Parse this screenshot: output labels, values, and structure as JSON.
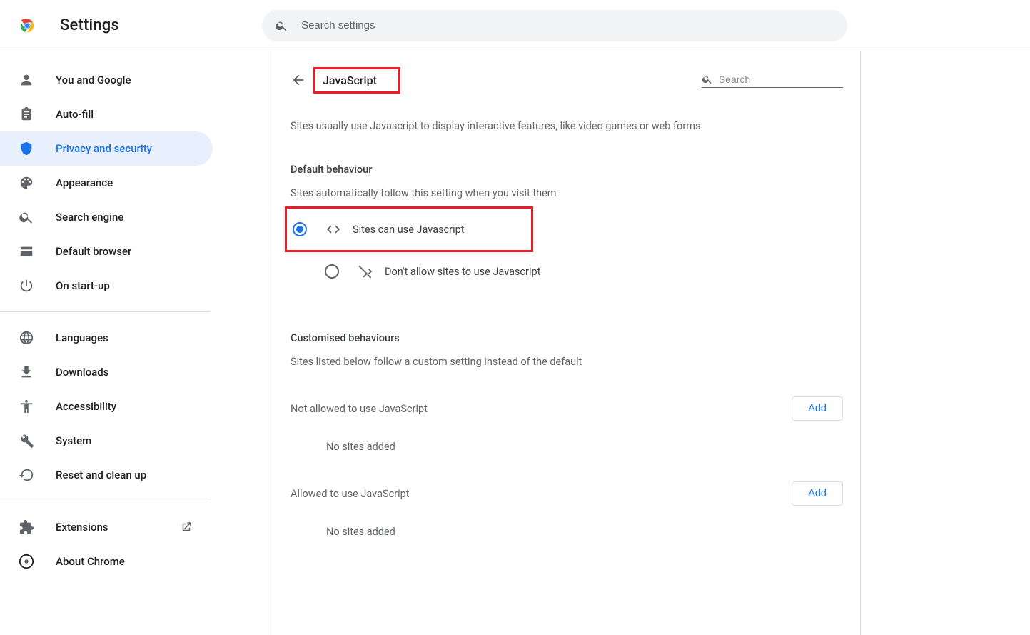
{
  "header": {
    "title": "Settings",
    "search_placeholder": "Search settings"
  },
  "sidebar": {
    "items": [
      {
        "id": "you-and-google",
        "label": "You and Google",
        "icon": "user"
      },
      {
        "id": "autofill",
        "label": "Auto-fill",
        "icon": "clipboard"
      },
      {
        "id": "privacy-security",
        "label": "Privacy and security",
        "icon": "shield",
        "active": true
      },
      {
        "id": "appearance",
        "label": "Appearance",
        "icon": "palette"
      },
      {
        "id": "search-engine",
        "label": "Search engine",
        "icon": "search"
      },
      {
        "id": "default-browser",
        "label": "Default browser",
        "icon": "window"
      },
      {
        "id": "on-startup",
        "label": "On start-up",
        "icon": "power"
      }
    ],
    "items2": [
      {
        "id": "languages",
        "label": "Languages",
        "icon": "globe"
      },
      {
        "id": "downloads",
        "label": "Downloads",
        "icon": "download"
      },
      {
        "id": "accessibility",
        "label": "Accessibility",
        "icon": "accessibility"
      },
      {
        "id": "system",
        "label": "System",
        "icon": "wrench"
      },
      {
        "id": "reset",
        "label": "Reset and clean up",
        "icon": "restore"
      }
    ],
    "items3": [
      {
        "id": "extensions",
        "label": "Extensions",
        "icon": "extension",
        "external": true
      },
      {
        "id": "about",
        "label": "About Chrome",
        "icon": "chrome"
      }
    ]
  },
  "main": {
    "title": "JavaScript",
    "search_placeholder": "Search",
    "description": "Sites usually use Javascript to display interactive features, like video games or web forms",
    "default_behaviour": {
      "heading": "Default behaviour",
      "sub": "Sites automatically follow this setting when you visit them",
      "options": [
        {
          "id": "allow",
          "label": "Sites can use Javascript",
          "selected": true,
          "icon": "code"
        },
        {
          "id": "block",
          "label": "Don't allow sites to use Javascript",
          "selected": false,
          "icon": "code-off"
        }
      ]
    },
    "customised": {
      "heading": "Customised behaviours",
      "sub": "Sites listed below follow a custom setting instead of the default",
      "lists": [
        {
          "id": "not-allowed",
          "label": "Not allowed to use JavaScript",
          "button": "Add",
          "empty": "No sites added"
        },
        {
          "id": "allowed",
          "label": "Allowed to use JavaScript",
          "button": "Add",
          "empty": "No sites added"
        }
      ]
    }
  }
}
